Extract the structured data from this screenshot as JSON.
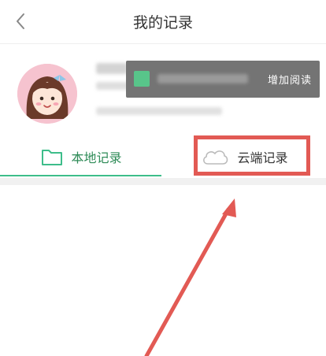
{
  "header": {
    "title": "我的记录",
    "back_icon": "chevron-left-icon"
  },
  "profile": {
    "avatar_icon": "cartoon-girl-avatar"
  },
  "toast": {
    "text": "增加阅读"
  },
  "tabs": [
    {
      "label": "本地记录",
      "icon": "folder-icon",
      "active": true
    },
    {
      "label": "云端记录",
      "icon": "cloud-icon",
      "active": false
    }
  ],
  "colors": {
    "accent": "#3dbd8a",
    "annotation": "#e25a54"
  }
}
